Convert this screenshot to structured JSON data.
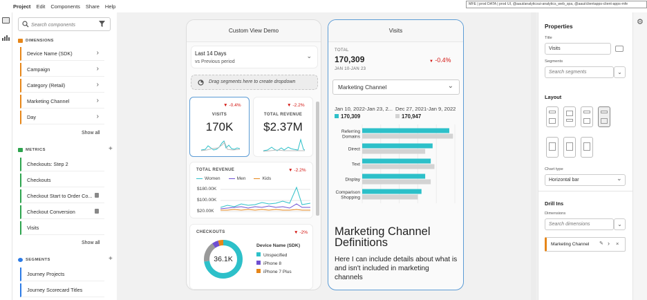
{
  "menu": [
    "Project",
    "Edit",
    "Components",
    "Share",
    "Help"
  ],
  "tooltip": "MFE | prod DATA | prod UI, @aaui/analyticsui-analytics_web_spa, @aaui/clientapps-client-apps-mfe",
  "left": {
    "search_placeholder": "Search components",
    "dimensions_title": "DIMENSIONS",
    "dimensions": [
      "Device Name (SDK)",
      "Campaign",
      "Category (Retail)",
      "Marketing Channel",
      "Day"
    ],
    "show_all": "Show all",
    "metrics_title": "METRICS",
    "metrics": [
      "Checkouts: Step 2",
      "Checkouts",
      "Checkout Start to Order Co...",
      "Checkout Conversion",
      "Visits"
    ],
    "segments_title": "SEGMENTS",
    "segments": [
      "Journey Projects",
      "Journey Scorecard Titles"
    ]
  },
  "panelA": {
    "title": "Custom View Demo",
    "date_range": "Last 14 Days",
    "compare": "vs Previous period",
    "drop_hint": "Drag segments here to create dropdown",
    "visits": {
      "label": "VISITS",
      "change": "-0.4%",
      "value": "170K"
    },
    "revenue_small": {
      "label": "TOTAL REVENUE",
      "change": "-2.2%",
      "value": "$2.37M"
    },
    "revenue_chart": {
      "label": "TOTAL REVENUE",
      "change": "-2.2%",
      "legend": [
        "Women",
        "Men",
        "Kids"
      ],
      "yticks": [
        "$180.00K",
        "$100.00K",
        "$20.00K"
      ]
    },
    "checkouts": {
      "label": "CHECKOUTS",
      "change": "-2%",
      "value": "36.1K",
      "legend_title": "Device Name (SDK)",
      "legend": [
        "Unspecified",
        "iPhone 8",
        "iPhone 7 Plus"
      ]
    }
  },
  "panelB": {
    "title": "Visits",
    "total_label": "TOTAL",
    "total_value": "170,309",
    "total_change": "-0.4%",
    "total_range": "JAN 10-JAN 23",
    "dropdown": "Marketing Channel",
    "range_current": "Jan 10, 2022-Jan 23, 2...",
    "range_previous": "Dec 27, 2021-Jan 9, 2022",
    "value_current": "170,309",
    "value_previous": "170,947",
    "text_heading": "Marketing Channel Definitions",
    "text_body": "Here I can include details about what is and isn't included in marketing channels"
  },
  "chart_data": {
    "type": "bar",
    "orientation": "horizontal",
    "categories": [
      "Referring Domains",
      "Direct",
      "Text",
      "Display",
      "Comparison Shopping"
    ],
    "series": [
      {
        "name": "Jan 10, 2022-Jan 23, 2...",
        "values": [
          47000,
          38000,
          37000,
          34000,
          32000
        ]
      },
      {
        "name": "Dec 27, 2021-Jan 9, 2022",
        "values": [
          49000,
          34000,
          39000,
          37000,
          30000
        ]
      }
    ],
    "xticks": [
      "0",
      "10K",
      "20K",
      "30K",
      "40K",
      "50K"
    ],
    "xlim": [
      0,
      50000
    ]
  },
  "right": {
    "title": "Properties",
    "title_label": "Title",
    "title_value": "Visits",
    "segments_label": "Segments",
    "segments_placeholder": "Search segments",
    "layout_label": "Layout",
    "charttype_label": "Chart type",
    "charttype_value": "Horizontal bar",
    "drillins_title": "Drill Ins",
    "dimensions_label": "Dimensions",
    "dimensions_placeholder": "Search dimensions",
    "drill_item": "Marketing Channel"
  },
  "colors": {
    "teal": "#2dc0c9",
    "gray": "#d3d3d3",
    "negative": "#d31510",
    "orange": "#e68619",
    "purple": "#6e4fd1",
    "blue": "#2c7be5"
  }
}
